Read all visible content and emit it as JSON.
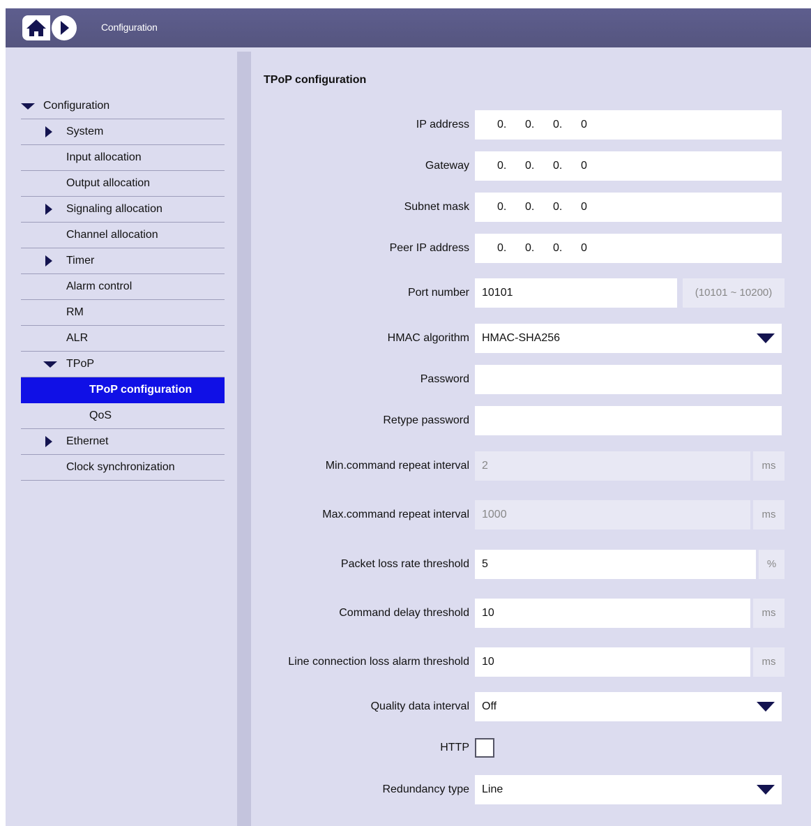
{
  "header": {
    "title": "Configuration",
    "home_icon": "home-icon",
    "forward_icon": "play-circle-icon"
  },
  "sidebar": {
    "items": [
      {
        "label": "Configuration",
        "arrow": "down",
        "level": 0
      },
      {
        "label": "System",
        "arrow": "right",
        "level": 1
      },
      {
        "label": "Input allocation",
        "arrow": "",
        "level": 1
      },
      {
        "label": "Output allocation",
        "arrow": "",
        "level": 1
      },
      {
        "label": "Signaling allocation",
        "arrow": "right",
        "level": 1
      },
      {
        "label": "Channel allocation",
        "arrow": "",
        "level": 1
      },
      {
        "label": "Timer",
        "arrow": "right",
        "level": 1
      },
      {
        "label": "Alarm control",
        "arrow": "",
        "level": 1
      },
      {
        "label": "RM",
        "arrow": "",
        "level": 1
      },
      {
        "label": "ALR",
        "arrow": "",
        "level": 1
      },
      {
        "label": "TPoP",
        "arrow": "down",
        "level": 1
      },
      {
        "label": "TPoP configuration",
        "arrow": "",
        "level": 2,
        "selected": true
      },
      {
        "label": "QoS",
        "arrow": "",
        "level": 2
      },
      {
        "label": "Ethernet",
        "arrow": "right",
        "level": 1
      },
      {
        "label": "Clock synchronization",
        "arrow": "",
        "level": 1
      }
    ]
  },
  "form": {
    "title": "TPoP configuration",
    "ip_address": {
      "label": "IP address",
      "octets": [
        "0.",
        "0.",
        "0.",
        "0"
      ]
    },
    "gateway": {
      "label": "Gateway",
      "octets": [
        "0.",
        "0.",
        "0.",
        "0"
      ]
    },
    "subnet_mask": {
      "label": "Subnet mask",
      "octets": [
        "0.",
        "0.",
        "0.",
        "0"
      ]
    },
    "peer_ip": {
      "label": "Peer IP address",
      "octets": [
        "0.",
        "0.",
        "0.",
        "0"
      ]
    },
    "port": {
      "label": "Port number",
      "value": "10101",
      "range": "(10101 ~ 10200)"
    },
    "hmac": {
      "label": "HMAC algorithm",
      "value": "HMAC-SHA256"
    },
    "password": {
      "label": "Password",
      "value": ""
    },
    "retype_password": {
      "label": "Retype password",
      "value": ""
    },
    "min_repeat": {
      "label": "Min.command repeat interval",
      "value": "2",
      "unit": "ms"
    },
    "max_repeat": {
      "label": "Max.command repeat interval",
      "value": "1000",
      "unit": "ms"
    },
    "packet_loss": {
      "label": "Packet loss rate threshold",
      "value": "5",
      "unit": "%"
    },
    "cmd_delay": {
      "label": "Command delay threshold",
      "value": "10",
      "unit": "ms"
    },
    "line_loss": {
      "label": "Line connection loss alarm threshold",
      "value": "10",
      "unit": "ms"
    },
    "quality_interval": {
      "label": "Quality data interval",
      "value": "Off"
    },
    "http": {
      "label": "HTTP",
      "checked": false
    },
    "redundancy": {
      "label": "Redundancy type",
      "value": "Line"
    }
  },
  "colors": {
    "header_bg": "#5a5a88",
    "panel_bg": "#dcdcef",
    "selected_bg": "#1010e6",
    "arrow": "#141450"
  }
}
